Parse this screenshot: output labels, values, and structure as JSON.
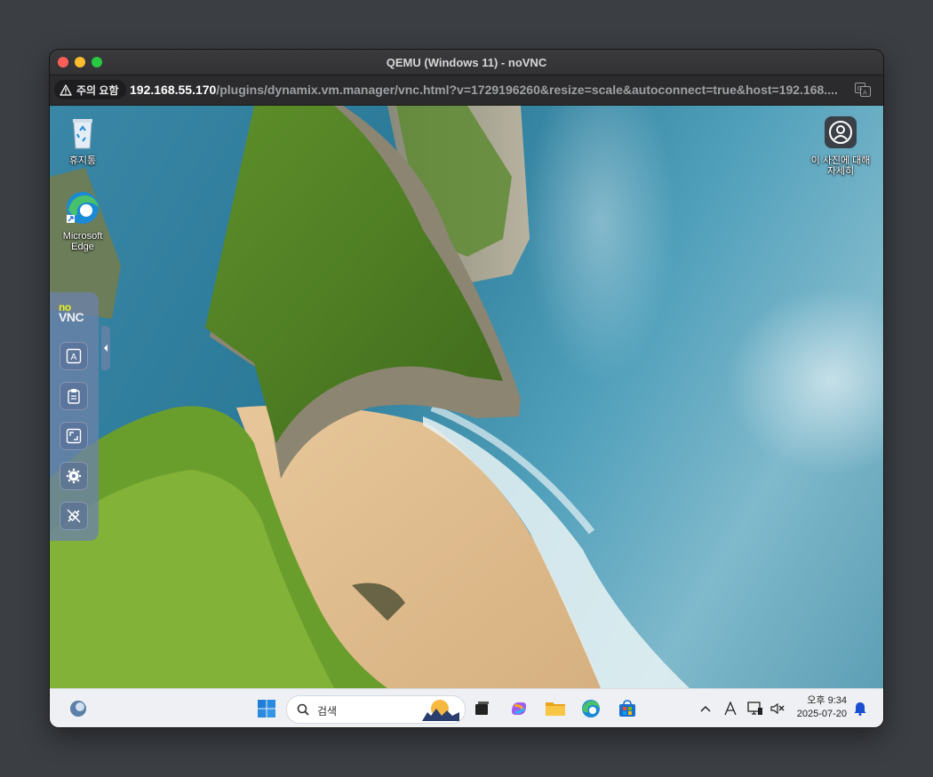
{
  "window": {
    "title": "QEMU (Windows 11) - noVNC"
  },
  "urlbar": {
    "warning_label": "주의 요함",
    "url_host": "192.168.55.170",
    "url_path": "/plugins/dynamix.vm.manager/vnc.html?v=1729196260&resize=scale&autoconnect=true&host=192.168...."
  },
  "desktop": {
    "icons": [
      {
        "label": "휴지통"
      },
      {
        "label": "Microsoft Edge"
      },
      {
        "label": "이 사진에 대해 자세히"
      }
    ]
  },
  "novnc": {
    "logo_top": "no",
    "logo_bottom": "VNC"
  },
  "taskbar": {
    "search_placeholder": "검색",
    "time": "오후 9:34",
    "date": "2025-07-20"
  }
}
